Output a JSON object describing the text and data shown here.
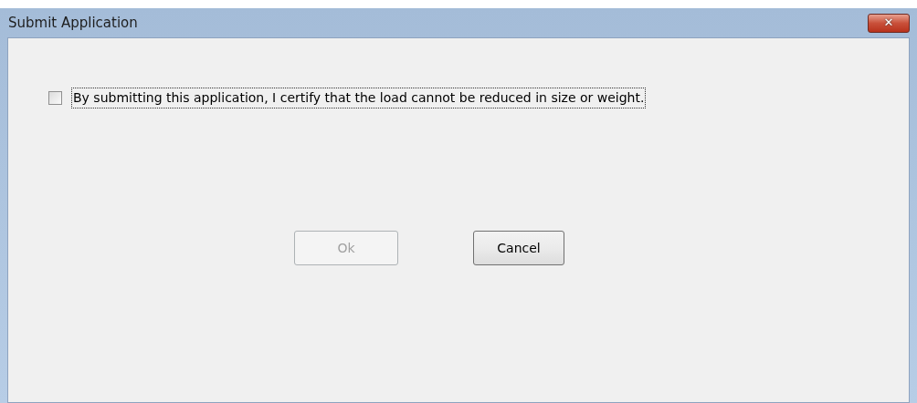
{
  "window": {
    "title": "Submit Application",
    "close_label": "✕"
  },
  "checkbox": {
    "label": "By submitting this application, I certify that the load cannot be reduced in size or weight.",
    "checked": false,
    "focused": true
  },
  "buttons": [
    {
      "label": "Ok",
      "disabled": true
    },
    {
      "label": "Cancel",
      "disabled": false
    }
  ]
}
